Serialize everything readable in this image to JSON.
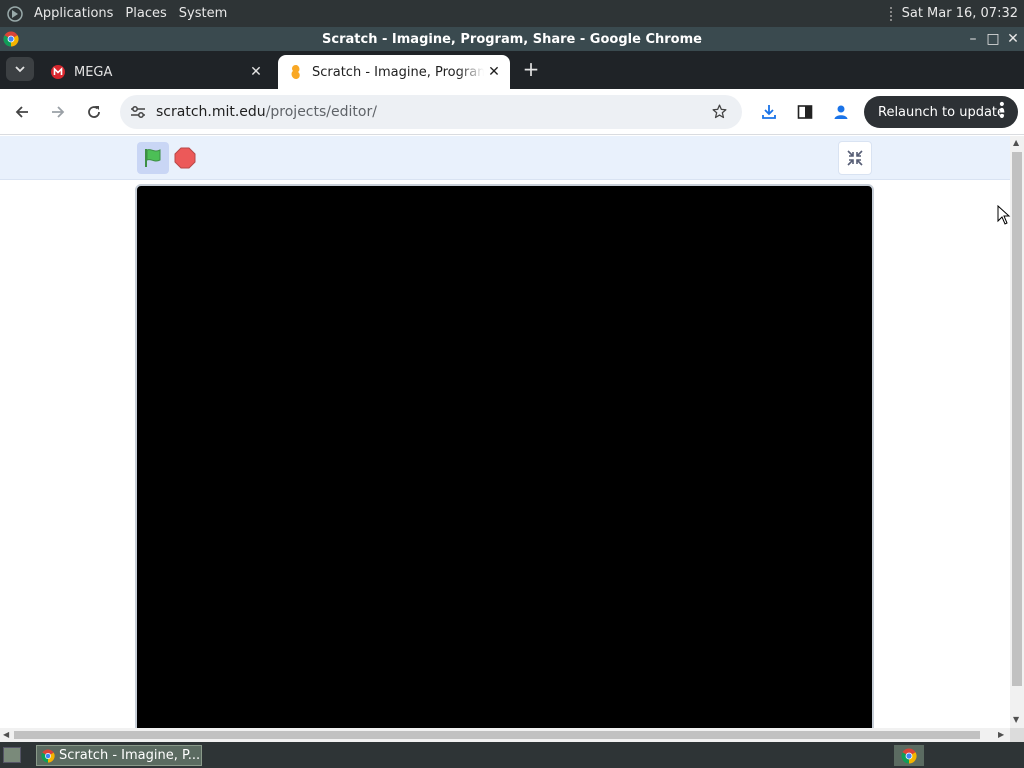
{
  "top_panel": {
    "menus": [
      "Applications",
      "Places",
      "System"
    ],
    "clock": "Sat Mar 16, 07:32"
  },
  "window": {
    "title": "Scratch - Imagine, Program, Share - Google Chrome"
  },
  "tabs": [
    {
      "title": "MEGA",
      "active": false,
      "favicon": "mega-icon"
    },
    {
      "title": "Scratch - Imagine, Program, Share",
      "active": true,
      "favicon": "scratch-icon"
    }
  ],
  "toolbar": {
    "url_host": "scratch.mit.edu",
    "url_path": "/projects/editor/",
    "relaunch_label": "Relaunch to update"
  },
  "stage": {
    "background_color": "#000000"
  },
  "taskbar": {
    "items": [
      {
        "label": "Scratch - Imagine, P..."
      }
    ]
  },
  "colors": {
    "panel_bg": "#2e3436",
    "chrome_titlebar": "#3a4a4f",
    "stage_header_bg": "#e9f1fc",
    "flag_green": "#4cbf56",
    "stop_red": "#ec5959"
  }
}
